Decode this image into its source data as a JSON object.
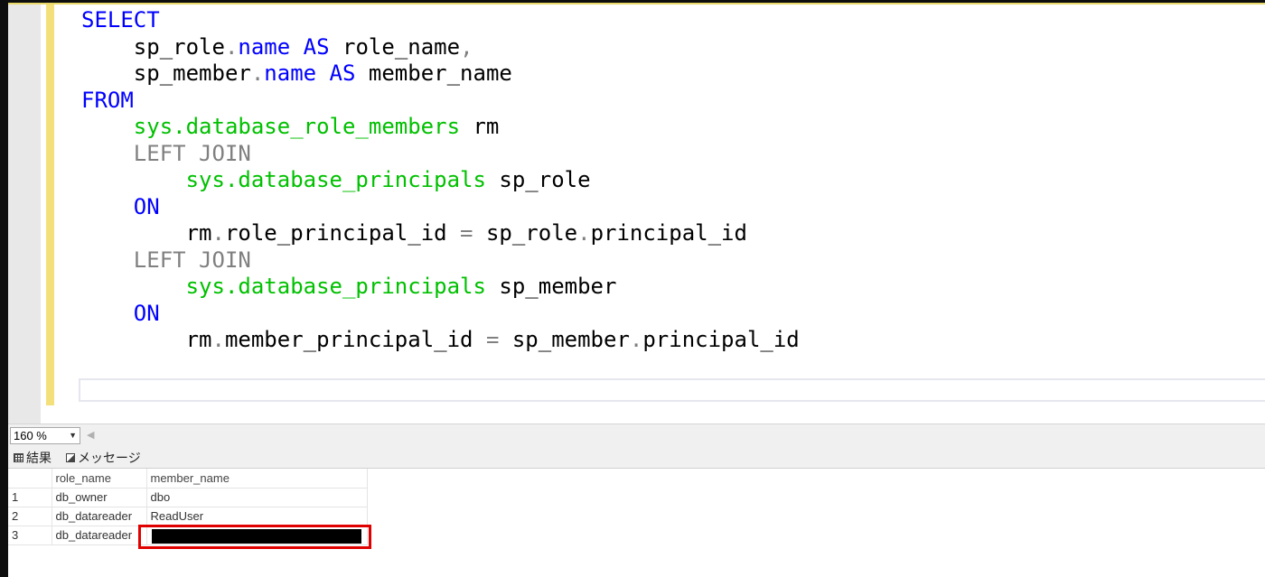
{
  "editor": {
    "code": {
      "l1_select": "SELECT",
      "l2_a": "sp_role",
      "l2_dot": ".",
      "l2_name": "name",
      "l2_as": "AS",
      "l2_alias": "role_name",
      "l2_comma": ",",
      "l3_a": "sp_member",
      "l3_dot": ".",
      "l3_name": "name",
      "l3_as": "AS",
      "l3_alias": "member_name",
      "l4_from": "FROM",
      "l5_table": "sys.database_role_members",
      "l5_alias": "rm",
      "l6_join": "LEFT JOIN",
      "l7_table": "sys.database_principals",
      "l7_alias": "sp_role",
      "l8_on": "ON",
      "l9_a": "rm",
      "l9_dot": ".",
      "l9_col": "role_principal_id",
      "l9_eq": "=",
      "l9_b": "sp_role",
      "l9_dot2": ".",
      "l9_col2": "principal_id",
      "l10_join": "LEFT JOIN",
      "l11_table": "sys.database_principals",
      "l11_alias": "sp_member",
      "l12_on": "ON",
      "l13_a": "rm",
      "l13_dot": ".",
      "l13_col": "member_principal_id",
      "l13_eq": "=",
      "l13_b": "sp_member",
      "l13_dot2": ".",
      "l13_col2": "principal_id"
    },
    "colors": {
      "keyword": "#0000ff",
      "system_object": "#00c000",
      "join_keyword": "#808080",
      "change_bar": "#f3e07a"
    }
  },
  "zoom": {
    "value": "160 %",
    "arrow_icon": "chevron-down-icon"
  },
  "results_tabs": {
    "results_label": "結果",
    "messages_label": "メッセージ"
  },
  "results": {
    "columns": [
      "role_name",
      "member_name"
    ],
    "rows": [
      {
        "index": "1",
        "role_name": "db_owner",
        "member_name": "dbo"
      },
      {
        "index": "2",
        "role_name": "db_datareader",
        "member_name": "ReadUser"
      },
      {
        "index": "3",
        "role_name": "db_datareader",
        "member_name": ""
      }
    ],
    "highlight_color": "#e00000"
  }
}
